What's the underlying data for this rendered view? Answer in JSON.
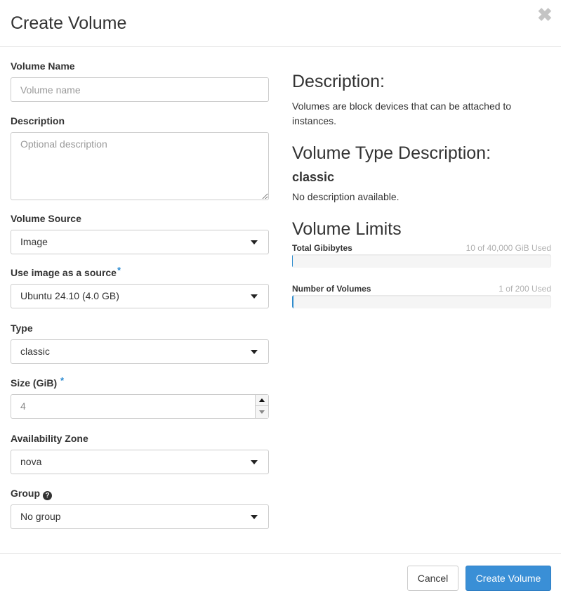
{
  "modal": {
    "title": "Create Volume",
    "close_symbol": "✖"
  },
  "form": {
    "volume_name": {
      "label": "Volume Name",
      "value": "",
      "placeholder": "Volume name"
    },
    "description": {
      "label": "Description",
      "value": "",
      "placeholder": "Optional description"
    },
    "volume_source": {
      "label": "Volume Source",
      "selected": "Image"
    },
    "image_source": {
      "label": "Use image as a source",
      "required_mark": "*",
      "selected": "Ubuntu 24.10 (4.0 GB)"
    },
    "type": {
      "label": "Type",
      "selected": "classic"
    },
    "size": {
      "label": "Size (GiB)",
      "required_mark": "*",
      "value": "4"
    },
    "availability_zone": {
      "label": "Availability Zone",
      "selected": "nova"
    },
    "group": {
      "label": "Group",
      "help_symbol": "?",
      "selected": "No group"
    }
  },
  "info": {
    "description_heading": "Description:",
    "description_text": "Volumes are block devices that can be attached to instances.",
    "type_heading": "Volume Type Description:",
    "type_name": "classic",
    "type_text": "No description available.",
    "limits_heading": "Volume Limits",
    "limits": [
      {
        "label": "Total Gibibytes",
        "used_text": "10 of 40,000 GiB Used",
        "fraction": 0.00025
      },
      {
        "label": "Number of Volumes",
        "used_text": "1 of 200 Used",
        "fraction": 0.005
      }
    ]
  },
  "footer": {
    "cancel_label": "Cancel",
    "submit_label": "Create Volume"
  },
  "colors": {
    "accent": "#3a8fd6",
    "required": "#2b8bd1"
  }
}
